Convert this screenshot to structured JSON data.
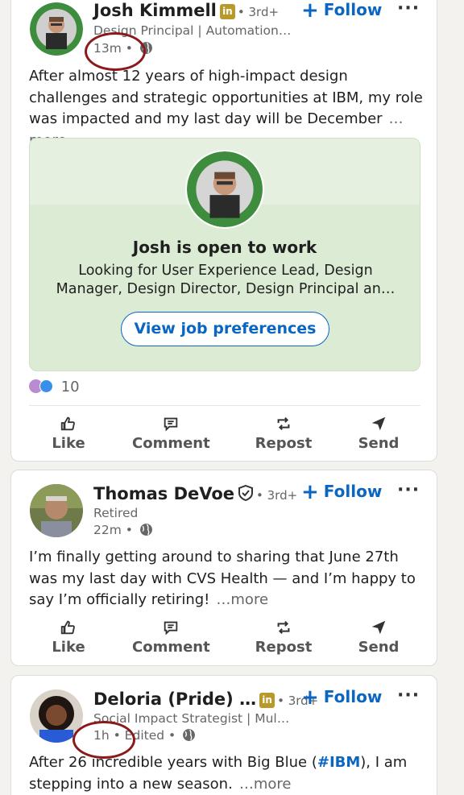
{
  "posts": [
    {
      "author": "Josh Kimmell",
      "degree": "• 3rd+",
      "headline": "Design Principal | Automation Experience Strategy",
      "time": "13m •",
      "follow": "Follow",
      "menu": "···",
      "body": "After almost 12 years of high-impact design challenges and strategic opportunities at IBM, my role was impacted and my last day will be December",
      "more": "…more",
      "open_to_work": {
        "title": "Josh is open to work",
        "desc": "Looking for User Experience Lead, Design Manager, Design Director, Design Principal an…",
        "button": "View job preferences"
      },
      "reactions_count": "10"
    },
    {
      "author": "Thomas DeVoe",
      "degree": "• 3rd+",
      "headline": "Retired",
      "time": "22m •",
      "follow": "Follow",
      "menu": "···",
      "body": "I’m finally getting around to sharing that June 27th was my last day with CVS Health — and I’m happy to say I’m officially retiring!",
      "more": "…more"
    },
    {
      "author": "Deloria (Pride) …",
      "degree": "• 3rd+",
      "headline": "Social Impact Strategist | Multicultural Leader",
      "time": "1h • Edited •",
      "follow": "Follow",
      "menu": "···",
      "body_before": "After 26 incredible years with Big Blue (",
      "hashtag": "#IBM",
      "body_after": "), I am stepping into a new season.",
      "more": "…more"
    }
  ],
  "actions": {
    "like": "Like",
    "comment": "Comment",
    "repost": "Repost",
    "send": "Send"
  },
  "badges": {
    "linkedin": "in"
  },
  "colors": {
    "accent": "#0a66c2",
    "annotation": "#8b1a1a",
    "open_to_work_bg": "#dcebd4"
  }
}
